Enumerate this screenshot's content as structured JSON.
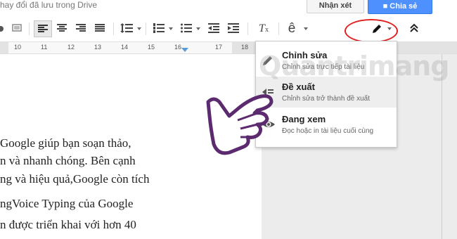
{
  "header": {
    "save_status": "hay đổi đã lưu trong Drive",
    "comment_button": "Nhận xét",
    "share_button": "Chia sẻ"
  },
  "toolbar": {
    "font_size_label": "ê",
    "icons": [
      "print-icon",
      "paint-format-icon",
      "align-left-icon",
      "align-center-icon",
      "align-right-icon",
      "align-justify-icon",
      "line-spacing-icon",
      "numbered-list-icon",
      "bulleted-list-icon",
      "decrease-indent-icon",
      "increase-indent-icon",
      "clear-formatting-icon",
      "input-tools-icon",
      "pencil-icon",
      "collapse-icon"
    ]
  },
  "ruler": {
    "labels": [
      "10",
      "11",
      "12",
      "13",
      "14",
      "15",
      "16",
      "17",
      "18"
    ]
  },
  "document": {
    "lines": [
      "Google giúp bạn soạn thảo,",
      "n và nhanh chóng. Bên cạnh",
      "ng và hiệu quả,Google còn tích",
      "ngVoice Typing của Google",
      "n được triển khai với hơn 40"
    ]
  },
  "mode_menu": {
    "items": [
      {
        "title": "Chỉnh sửa",
        "subtitle": "Chỉnh sửa trực tiếp tài liệu",
        "icon": "pencil-icon"
      },
      {
        "title": "Đề xuất",
        "subtitle": "Chỉnh sửa trở thành đề xuất",
        "icon": "suggest-icon"
      },
      {
        "title": "Đang xem",
        "subtitle": "Đọc hoặc in tài liệu cuối cùng",
        "icon": "eye-icon"
      }
    ]
  },
  "watermark": "Quantrimang",
  "colors": {
    "accent": "#4d90fe",
    "highlight": "#e02020",
    "hand": "#5c2a6e"
  }
}
